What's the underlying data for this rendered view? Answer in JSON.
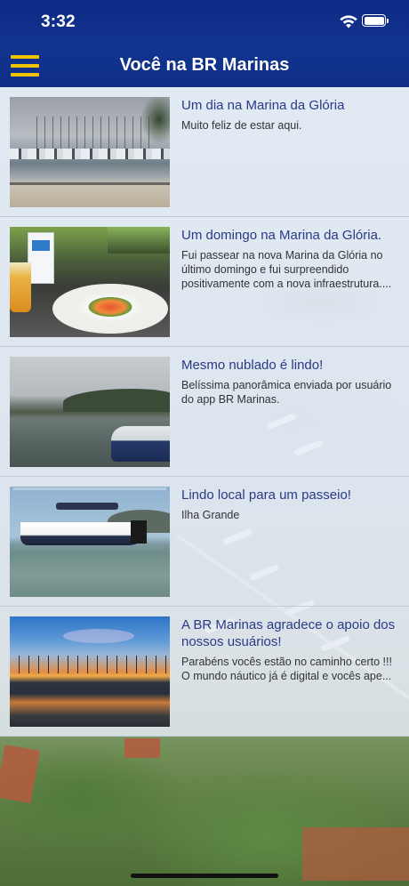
{
  "status_bar": {
    "time": "3:32"
  },
  "header": {
    "title": "Você na BR Marinas"
  },
  "icons": {
    "menu": "hamburger-menu-icon",
    "wifi": "wifi-icon",
    "battery": "battery-icon"
  },
  "colors": {
    "header_bg": "#12348f",
    "menu_accent": "#f2c300",
    "title_blue": "#2a3a87",
    "item_bg": "#e8eef7"
  },
  "posts": [
    {
      "title": "Um dia na Marina da Glória",
      "description": "Muito feliz de estar aqui."
    },
    {
      "title": "Um domingo na Marina da Glória.",
      "description": "Fui passear na nova Marina da Glória no último domingo e fui surpreendido positivamente com a nova infraestrutura...."
    },
    {
      "title": "Mesmo nublado é lindo!",
      "description": "Belíssima panorâmica enviada por usuário do app BR Marinas."
    },
    {
      "title": "Lindo local para um passeio!",
      "description": "Ilha Grande"
    },
    {
      "title": "A BR Marinas agradece o apoio dos nossos usuários!",
      "description": "Parabéns vocês estão no caminho certo !!! O mundo  náutico já é digital  e vocês ape..."
    }
  ]
}
